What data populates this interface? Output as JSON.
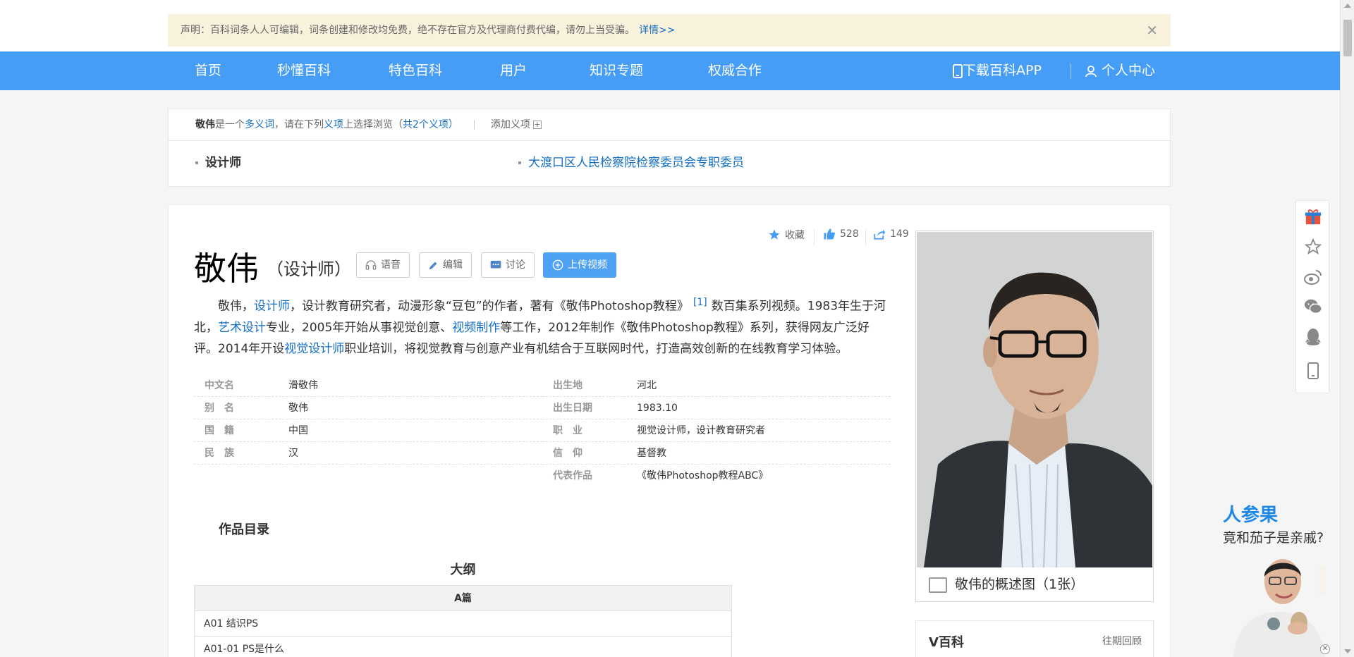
{
  "notice": {
    "text": "声明：百科词条人人可编辑，词条创建和修改均免费，绝不存在官方及代理商付费代编，请勿上当受骗。",
    "detail_link": "详情>>"
  },
  "nav": {
    "items": [
      "首页",
      "秒懂百科",
      "特色百科",
      "用户",
      "知识专题",
      "权威合作"
    ],
    "download_app": "下载百科APP",
    "user_center": "个人中心"
  },
  "polysemant": {
    "term": "敬伟",
    "text1": "是一个",
    "polysemy_link": "多义词",
    "text2": "，请在下列",
    "sense_link": "义项",
    "text3": "上选择浏览（",
    "count_link": "共2个义项",
    "text4": "）",
    "add_sense": "添加义项",
    "senses": [
      "设计师",
      "大渡口区人民检察院检察委员会专职委员"
    ]
  },
  "article": {
    "title": "敬伟",
    "subtitle": "（设计师）",
    "buttons": {
      "voice": "语音",
      "edit": "编辑",
      "discuss": "讨论",
      "upload_video": "上传视频"
    },
    "stats": {
      "collect": "收藏",
      "likes": "528",
      "shares": "149"
    },
    "summary": {
      "p1": "敬伟，",
      "l1": "设计师",
      "p2": "，设计教育研究者，动漫形象“豆包”的作者，著有《敬伟Photoshop教程》",
      "ref": "[1]",
      "p3": "数百集系列视频。1983年生于河北，",
      "l2": "艺术设计",
      "p4": "专业，2005年开始从事视觉创意、",
      "l3": "视频制作",
      "p5": "等工作，2012年制作《敬伟Photoshop教程》系列，获得网友广泛好评。2014年开设",
      "l4": "视觉设计师",
      "p6": "职业培训，将视觉教育与创意产业有机结合于互联网时代，打造高效创新的在线教育学习体验。"
    },
    "info_left": [
      {
        "k": "中文名",
        "v": "滑敬伟"
      },
      {
        "k": "别　名",
        "v": "敬伟"
      },
      {
        "k": "国　籍",
        "v": "中国"
      },
      {
        "k": "民　族",
        "v": "汉"
      }
    ],
    "info_right": [
      {
        "k": "出生地",
        "v": "河北"
      },
      {
        "k": "出生日期",
        "v": "1983.10"
      },
      {
        "k": "职　业",
        "v": "视觉设计师，设计教育研究者"
      },
      {
        "k": "信　仰",
        "v": "基督教"
      },
      {
        "k": "代表作品",
        "v": "《敬伟Photoshop教程ABC》"
      }
    ],
    "catalog_title": "作品目录",
    "outline_title": "大纲",
    "outline_header": "A篇",
    "outline_rows": [
      "A01 结识PS",
      "A01-01 PS是什么"
    ]
  },
  "picture": {
    "caption": "敬伟的概述图（1张）"
  },
  "vbaike": {
    "title": "V百科",
    "link": "往期回顾"
  },
  "ad": {
    "line1": "人参果",
    "line2": "竟和茄子是亲戚?",
    "close": "✕"
  },
  "notice_close": "✕",
  "colors": {
    "nav_bg": "#459df5",
    "link": "#136ec2",
    "notice_bg": "#f8f1dc",
    "primary_btn": "#4fa1f4"
  }
}
